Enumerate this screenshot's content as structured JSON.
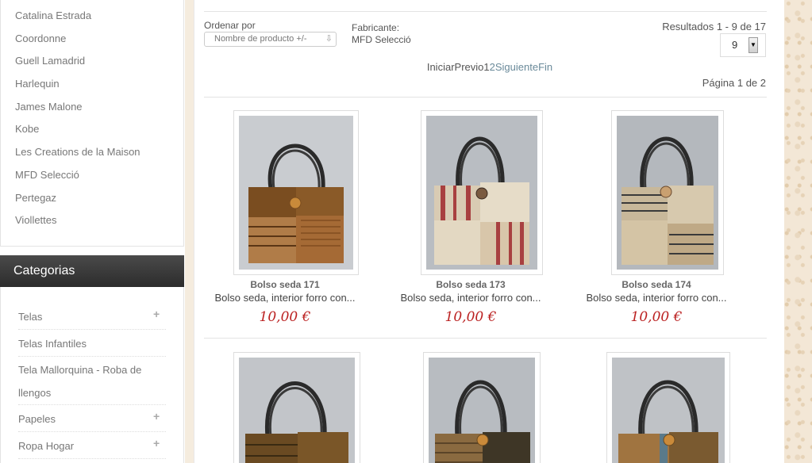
{
  "brands": [
    "Catalina Estrada",
    "Coordonne",
    "Guell Lamadrid",
    "Harlequin",
    "James Malone",
    "Kobe",
    "Les Creations de la Maison",
    "MFD Selecció",
    "Pertegaz",
    "Viollettes"
  ],
  "categories": {
    "title": "Categorias",
    "items": [
      {
        "label": "Telas"
      },
      {
        "label": "Telas Infantiles"
      },
      {
        "label": "Tela Mallorquina - Roba de llengos"
      },
      {
        "label": "Papeles"
      },
      {
        "label": "Ropa Hogar"
      }
    ]
  },
  "toolbar": {
    "sort_label": "Ordenar por",
    "sort_value": "Nombre de producto +/-",
    "maker_label": "Fabricante:",
    "maker_value": "MFD Selecció",
    "results": "Resultados 1 - 9 de 17",
    "per_page": "9"
  },
  "pagination": {
    "first": "Iniciar",
    "prev": "Previo",
    "page1": "1",
    "page2": "2",
    "next": "Siguiente",
    "last": "Fin",
    "page_of": "Página 1 de 2"
  },
  "products": [
    {
      "name": "Bolso seda 171",
      "desc": "Bolso seda, interior forro con...",
      "price": "10,00 €"
    },
    {
      "name": "Bolso seda 173",
      "desc": "Bolso seda, interior forro con...",
      "price": "10,00 €"
    },
    {
      "name": "Bolso seda 174",
      "desc": "Bolso seda, interior forro con...",
      "price": "10,00 €"
    }
  ]
}
